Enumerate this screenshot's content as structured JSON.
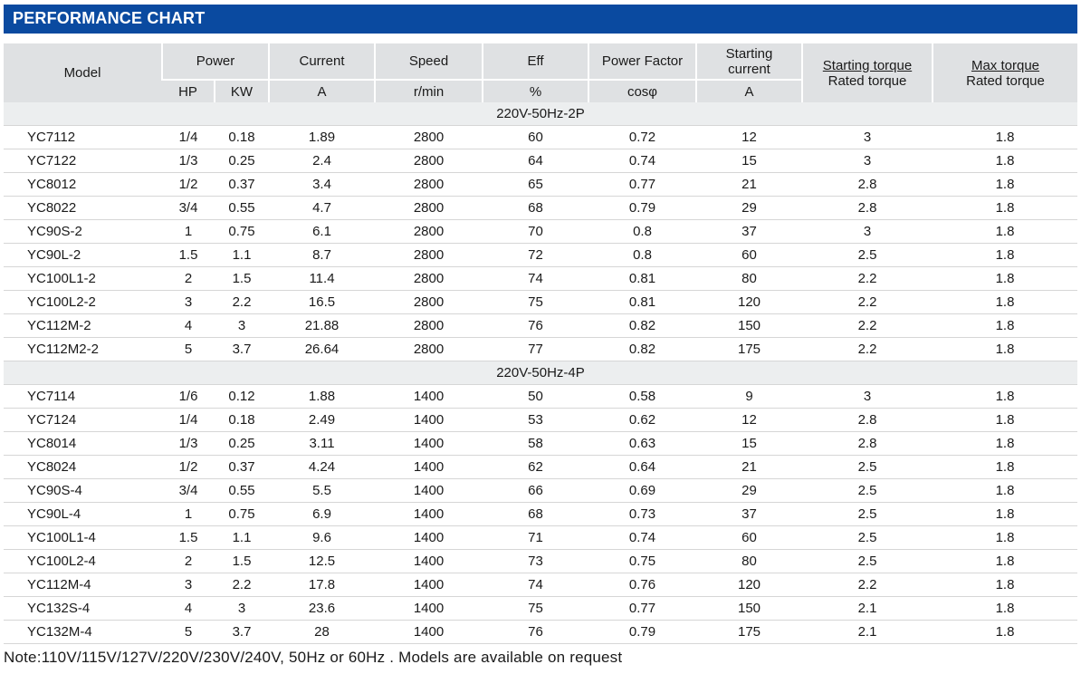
{
  "title": "PERFORMANCE CHART",
  "header": {
    "model": "Model",
    "power": "Power",
    "hp": "HP",
    "kw": "KW",
    "current": "Current",
    "current_unit": "A",
    "speed": "Speed",
    "speed_unit": "r/min",
    "eff": "Eff",
    "eff_unit": "%",
    "pf": "Power Factor",
    "pf_unit": "cosφ",
    "start_current_1": "Starting",
    "start_current_2": "current",
    "start_current_unit": "A",
    "start_torque_top": "Starting torque",
    "start_torque_bottom": "Rated torque",
    "max_torque_top": "Max torque",
    "max_torque_bottom": "Rated torque"
  },
  "sections": [
    {
      "label": "220V-50Hz-2P",
      "rows": [
        [
          "YC7112",
          "1/4",
          "0.18",
          "1.89",
          "2800",
          "60",
          "0.72",
          "12",
          "3",
          "1.8"
        ],
        [
          "YC7122",
          "1/3",
          "0.25",
          "2.4",
          "2800",
          "64",
          "0.74",
          "15",
          "3",
          "1.8"
        ],
        [
          "YC8012",
          "1/2",
          "0.37",
          "3.4",
          "2800",
          "65",
          "0.77",
          "21",
          "2.8",
          "1.8"
        ],
        [
          "YC8022",
          "3/4",
          "0.55",
          "4.7",
          "2800",
          "68",
          "0.79",
          "29",
          "2.8",
          "1.8"
        ],
        [
          "YC90S-2",
          "1",
          "0.75",
          "6.1",
          "2800",
          "70",
          "0.8",
          "37",
          "3",
          "1.8"
        ],
        [
          "YC90L-2",
          "1.5",
          "1.1",
          "8.7",
          "2800",
          "72",
          "0.8",
          "60",
          "2.5",
          "1.8"
        ],
        [
          "YC100L1-2",
          "2",
          "1.5",
          "11.4",
          "2800",
          "74",
          "0.81",
          "80",
          "2.2",
          "1.8"
        ],
        [
          "YC100L2-2",
          "3",
          "2.2",
          "16.5",
          "2800",
          "75",
          "0.81",
          "120",
          "2.2",
          "1.8"
        ],
        [
          "YC112M-2",
          "4",
          "3",
          "21.88",
          "2800",
          "76",
          "0.82",
          "150",
          "2.2",
          "1.8"
        ],
        [
          "YC112M2-2",
          "5",
          "3.7",
          "26.64",
          "2800",
          "77",
          "0.82",
          "175",
          "2.2",
          "1.8"
        ]
      ]
    },
    {
      "label": "220V-50Hz-4P",
      "rows": [
        [
          "YC7114",
          "1/6",
          "0.12",
          "1.88",
          "1400",
          "50",
          "0.58",
          "9",
          "3",
          "1.8"
        ],
        [
          "YC7124",
          "1/4",
          "0.18",
          "2.49",
          "1400",
          "53",
          "0.62",
          "12",
          "2.8",
          "1.8"
        ],
        [
          "YC8014",
          "1/3",
          "0.25",
          "3.11",
          "1400",
          "58",
          "0.63",
          "15",
          "2.8",
          "1.8"
        ],
        [
          "YC8024",
          "1/2",
          "0.37",
          "4.24",
          "1400",
          "62",
          "0.64",
          "21",
          "2.5",
          "1.8"
        ],
        [
          "YC90S-4",
          "3/4",
          "0.55",
          "5.5",
          "1400",
          "66",
          "0.69",
          "29",
          "2.5",
          "1.8"
        ],
        [
          "YC90L-4",
          "1",
          "0.75",
          "6.9",
          "1400",
          "68",
          "0.73",
          "37",
          "2.5",
          "1.8"
        ],
        [
          "YC100L1-4",
          "1.5",
          "1.1",
          "9.6",
          "1400",
          "71",
          "0.74",
          "60",
          "2.5",
          "1.8"
        ],
        [
          "YC100L2-4",
          "2",
          "1.5",
          "12.5",
          "1400",
          "73",
          "0.75",
          "80",
          "2.5",
          "1.8"
        ],
        [
          "YC112M-4",
          "3",
          "2.2",
          "17.8",
          "1400",
          "74",
          "0.76",
          "120",
          "2.2",
          "1.8"
        ],
        [
          "YC132S-4",
          "4",
          "3",
          "23.6",
          "1400",
          "75",
          "0.77",
          "150",
          "2.1",
          "1.8"
        ],
        [
          "YC132M-4",
          "5",
          "3.7",
          "28",
          "1400",
          "76",
          "0.79",
          "175",
          "2.1",
          "1.8"
        ]
      ]
    }
  ],
  "note": "Note:110V/115V/127V/220V/230V/240V, 50Hz or 60Hz . Models are available on request",
  "colors": {
    "title_bar": "#0a4aa0",
    "header_bg": "#dfe1e3",
    "section_bg": "#eceeef"
  }
}
